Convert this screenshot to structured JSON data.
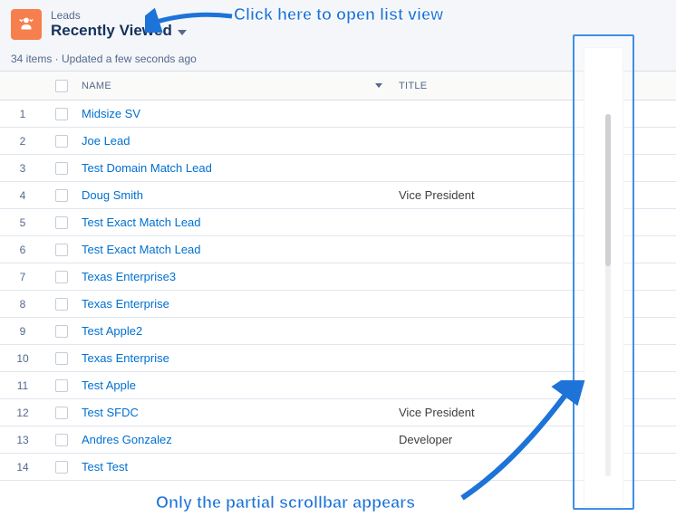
{
  "header": {
    "object_label": "Leads",
    "view_name": "Recently Viewed",
    "status": "34 items · Updated a few seconds ago"
  },
  "columns": {
    "name": "NAME",
    "title": "TITLE"
  },
  "rows": [
    {
      "num": "1",
      "name": "Midsize SV",
      "title": ""
    },
    {
      "num": "2",
      "name": "Joe Lead",
      "title": ""
    },
    {
      "num": "3",
      "name": "Test Domain Match Lead",
      "title": ""
    },
    {
      "num": "4",
      "name": "Doug Smith",
      "title": "Vice President"
    },
    {
      "num": "5",
      "name": "Test Exact Match Lead",
      "title": ""
    },
    {
      "num": "6",
      "name": "Test Exact Match Lead",
      "title": ""
    },
    {
      "num": "7",
      "name": "Texas Enterprise3",
      "title": ""
    },
    {
      "num": "8",
      "name": "Texas Enterprise",
      "title": ""
    },
    {
      "num": "9",
      "name": "Test Apple2",
      "title": ""
    },
    {
      "num": "10",
      "name": "Texas Enterprise",
      "title": ""
    },
    {
      "num": "11",
      "name": "Test Apple",
      "title": ""
    },
    {
      "num": "12",
      "name": "Test SFDC",
      "title": "Vice President"
    },
    {
      "num": "13",
      "name": "Andres Gonzalez",
      "title": "Developer"
    },
    {
      "num": "14",
      "name": "Test Test",
      "title": ""
    }
  ],
  "annotations": {
    "top": "Click here to open list view",
    "bottom": "Only the partial scrollbar appears"
  }
}
